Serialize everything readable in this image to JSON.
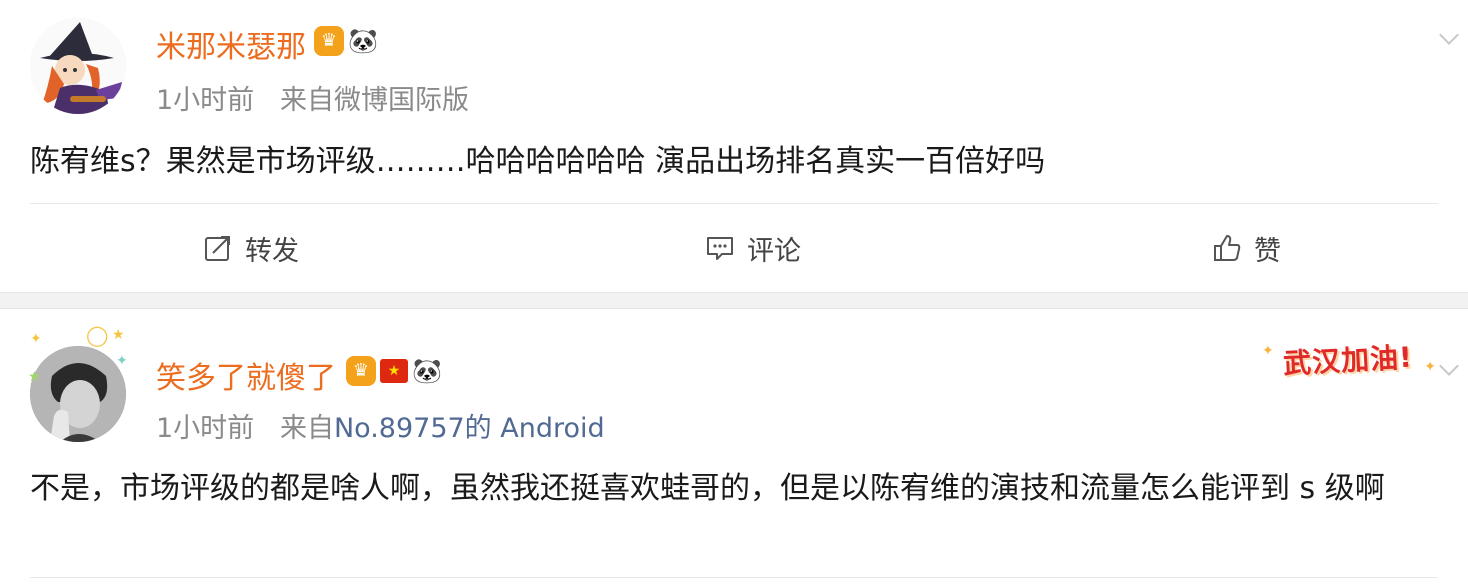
{
  "posts": [
    {
      "username": "米那米瑟那",
      "time": "1小时前",
      "source_prefix": "来自",
      "source": "微博国际版",
      "content": "陈宥维s？果然是市场评级………哈哈哈哈哈哈 演品出场排名真实一百倍好吗",
      "badges": [
        "crown-badge",
        "panda-icon"
      ],
      "actions": {
        "repost_label": "转发",
        "comment_label": "评论",
        "like_label": "赞"
      }
    },
    {
      "username": "笑多了就傻了",
      "time": "1小时前",
      "source_prefix": "来自",
      "source": "No.89757的 Android",
      "content": "不是，市场评级的都是啥人啊，虽然我还挺喜欢蛙哥的，但是以陈宥维的演技和流量怎么能评到 s 级啊",
      "badges": [
        "crown-badge",
        "china-flag-icon",
        "panda-icon"
      ],
      "decoration_text": "武汉加油!"
    }
  ],
  "colors": {
    "username": "#ec6d1f",
    "meta": "#8a8a8a",
    "link": "#516a93",
    "separator": "#f2f2f2",
    "decoration": "#e02a2a"
  }
}
